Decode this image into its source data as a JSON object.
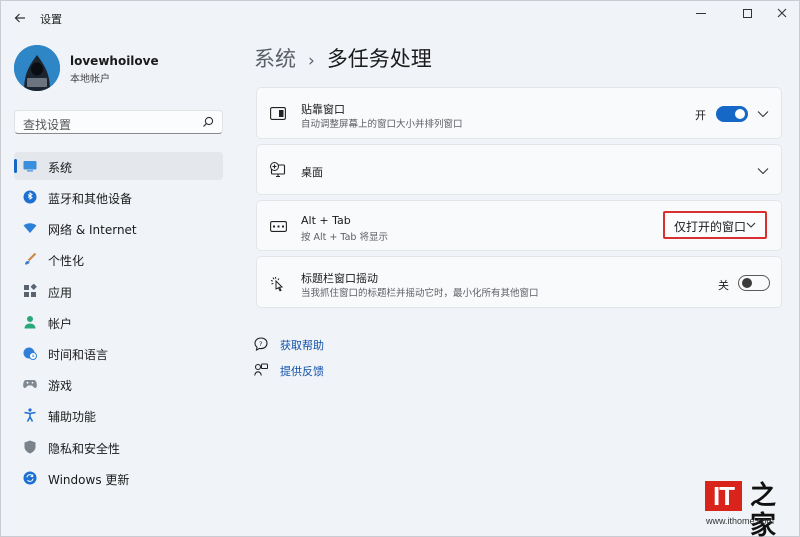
{
  "window": {
    "title": "设置"
  },
  "user": {
    "name": "lovewhoilove",
    "account_type": "本地帐户"
  },
  "search": {
    "placeholder": "查找设置"
  },
  "sidebar": {
    "items": [
      {
        "label": "系统",
        "icon": "system-icon"
      },
      {
        "label": "蓝牙和其他设备",
        "icon": "bluetooth-icon"
      },
      {
        "label": "网络 & Internet",
        "icon": "wifi-icon"
      },
      {
        "label": "个性化",
        "icon": "brush-icon"
      },
      {
        "label": "应用",
        "icon": "apps-icon"
      },
      {
        "label": "帐户",
        "icon": "person-icon"
      },
      {
        "label": "时间和语言",
        "icon": "globe-clock-icon"
      },
      {
        "label": "游戏",
        "icon": "gamepad-icon"
      },
      {
        "label": "辅助功能",
        "icon": "accessibility-icon"
      },
      {
        "label": "隐私和安全性",
        "icon": "shield-icon"
      },
      {
        "label": "Windows 更新",
        "icon": "update-icon"
      }
    ]
  },
  "header": {
    "parent": "系统",
    "separator": "›",
    "title": "多任务处理"
  },
  "settings": {
    "snap": {
      "title": "贴靠窗口",
      "desc": "自动调整屏幕上的窗口大小并排列窗口",
      "state_label": "开",
      "enabled": true
    },
    "desktops": {
      "title": "桌面"
    },
    "alttab": {
      "title": "Alt + Tab",
      "desc": "按 Alt + Tab 将显示",
      "selected": "仅打开的窗口"
    },
    "shake": {
      "title": "标题栏窗口摇动",
      "desc": "当我抓住窗口的标题栏并摇动它时，最小化所有其他窗口",
      "state_label": "关",
      "enabled": false
    }
  },
  "links": {
    "help": "获取帮助",
    "feedback": "提供反馈"
  },
  "watermark": {
    "logo_text": "IT",
    "glyph": "之家",
    "url": "www.ithome.com"
  },
  "colors": {
    "accent": "#1668c7",
    "highlight_border": "#d9302f",
    "link": "#1050a8"
  }
}
